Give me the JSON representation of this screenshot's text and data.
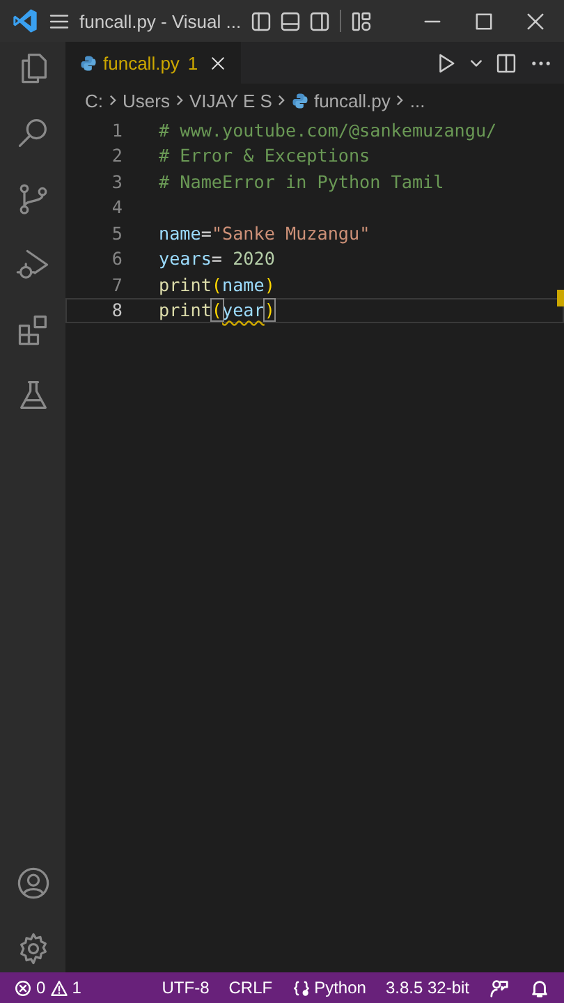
{
  "window": {
    "title": "funcall.py - Visual ..."
  },
  "activity_bar": {
    "top": [
      {
        "kind": "files",
        "selected": false
      },
      {
        "kind": "search",
        "selected": false
      },
      {
        "kind": "source",
        "selected": false
      },
      {
        "kind": "debug",
        "selected": false
      },
      {
        "kind": "extensions",
        "selected": false
      },
      {
        "kind": "flask",
        "selected": false
      }
    ],
    "bottom": [
      {
        "kind": "account"
      },
      {
        "kind": "gear"
      }
    ]
  },
  "tabs": [
    {
      "label": "funcall.py",
      "problems": "1",
      "selected": true,
      "warning": true
    }
  ],
  "breadcrumbs": [
    {
      "kind": "folder",
      "label": "C:"
    },
    {
      "kind": "folder",
      "label": "Users"
    },
    {
      "kind": "folder",
      "label": "VIJAY E S"
    },
    {
      "kind": "file",
      "label": "funcall.py"
    },
    {
      "kind": "folder",
      "label": "..."
    }
  ],
  "editor": {
    "lines": [
      {
        "number": "1",
        "tokens": [
          {
            "kind": "comment",
            "text": "# www.youtube.com/@sankemuzangu/"
          }
        ]
      },
      {
        "number": "2",
        "tokens": [
          {
            "kind": "comment",
            "text": "# Error & Exceptions"
          }
        ]
      },
      {
        "number": "3",
        "tokens": [
          {
            "kind": "comment",
            "text": "# NameError in Python Tamil"
          }
        ]
      },
      {
        "number": "4"
      },
      {
        "number": "5",
        "tokens": [
          {
            "kind": "var",
            "text": "name"
          },
          {
            "kind": "op",
            "text": "="
          },
          {
            "kind": "string",
            "text": "\"Sanke Muzangu\""
          }
        ]
      },
      {
        "number": "6",
        "tokens": [
          {
            "kind": "var",
            "text": "years"
          },
          {
            "kind": "op",
            "text": "= "
          },
          {
            "kind": "number",
            "text": "2020"
          }
        ]
      },
      {
        "number": "7",
        "tokens": [
          {
            "kind": "func",
            "text": "print"
          },
          {
            "kind": "paren",
            "text": "("
          },
          {
            "kind": "var",
            "text": "name"
          },
          {
            "kind": "paren",
            "text": ")"
          }
        ]
      },
      {
        "number": "8",
        "current": true,
        "tokens": [
          {
            "kind": "func",
            "text": "print"
          },
          {
            "kind": "paren",
            "text": "(",
            "matched": true
          },
          {
            "kind": "var",
            "text": "year",
            "error": true
          },
          {
            "kind": "paren",
            "text": ")",
            "matched": true
          }
        ]
      }
    ]
  },
  "status_bar": {
    "errors": "0",
    "warnings": "1",
    "items": [
      {
        "kind": "text",
        "label": "UTF-8"
      },
      {
        "kind": "text",
        "label": "CRLF"
      },
      {
        "kind": "language",
        "label": "Python"
      },
      {
        "kind": "text",
        "label": "3.8.5 32-bit"
      }
    ]
  }
}
